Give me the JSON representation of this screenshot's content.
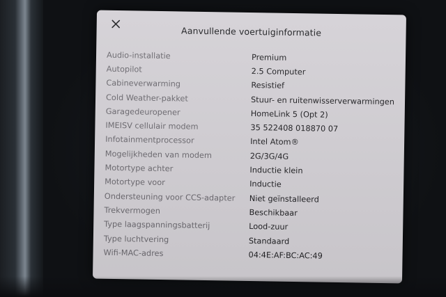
{
  "dialog": {
    "title": "Aanvullende voertuiginformatie",
    "close_icon": "close-icon",
    "rows": [
      {
        "label": "Audio-installatie",
        "value": "Premium"
      },
      {
        "label": "Autopilot",
        "value": "2.5 Computer"
      },
      {
        "label": "Cabineverwarming",
        "value": "Resistief"
      },
      {
        "label": "Cold Weather-pakket",
        "value": "Stuur- en ruitenwisserverwarmingen"
      },
      {
        "label": "Garagedeuropener",
        "value": "HomeLink 5 (Opt 2)"
      },
      {
        "label": "IMEISV cellulair modem",
        "value": "35 522408 018870 07"
      },
      {
        "label": "Infotainmentprocessor",
        "value": "Intel Atom®"
      },
      {
        "label": "Mogelijkheden van modem",
        "value": "2G/3G/4G"
      },
      {
        "label": "Motortype achter",
        "value": "Inductie klein"
      },
      {
        "label": "Motortype voor",
        "value": "Inductie"
      },
      {
        "label": "Ondersteuning voor CCS-adapter",
        "value": "Niet geïnstalleerd"
      },
      {
        "label": "Trekvermogen",
        "value": "Beschikbaar"
      },
      {
        "label": "Type laagspanningsbatterij",
        "value": "Lood-zuur"
      },
      {
        "label": "Type luchtvering",
        "value": "Standaard"
      },
      {
        "label": "Wifi-MAC-adres",
        "value": "04:4E:AF:BC:AC:49"
      }
    ]
  },
  "colors": {
    "panel_background": "#d4d1d6",
    "label_text": "#6c6a70",
    "value_text": "#1f1f22",
    "screen_background": "#0f1114"
  }
}
